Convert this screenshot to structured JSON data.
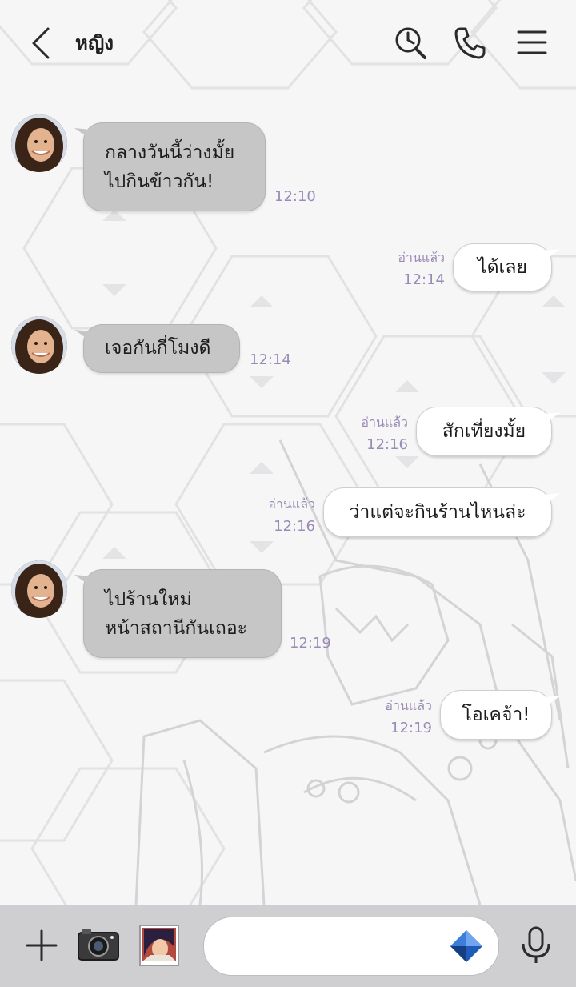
{
  "header": {
    "title": "หญิง",
    "back_icon": "chevron-left-icon",
    "actions": [
      "search-history-icon",
      "phone-icon",
      "menu-icon"
    ]
  },
  "messages": [
    {
      "side": "in",
      "lines": "กลางวันนี้ว่างมั้ย\nไปกินข้าวกัน!",
      "time": "12:10"
    },
    {
      "side": "out",
      "lines": "ได้เลย",
      "read": "อ่านแล้ว",
      "time": "12:14"
    },
    {
      "side": "in",
      "lines": "เจอกันกี่โมงดี",
      "time": "12:14"
    },
    {
      "side": "out",
      "lines": "สักเที่ยงมั้ย",
      "read": "อ่านแล้ว",
      "time": "12:16"
    },
    {
      "side": "out",
      "lines": "ว่าแต่จะกินร้านไหนล่ะ",
      "read": "อ่านแล้ว",
      "time": "12:16"
    },
    {
      "side": "in",
      "lines": "ไปร้านใหม่\nหน้าสถานีกันเถอะ",
      "time": "12:19"
    },
    {
      "side": "out",
      "lines": "โอเคจ้า!",
      "read": "อ่านแล้ว",
      "time": "12:19"
    }
  ],
  "footer": {
    "icons": [
      "plus-icon",
      "camera-icon",
      "photo-thumbnail",
      "diamond-icon",
      "microphone-icon"
    ],
    "input_value": ""
  },
  "colors": {
    "incoming_bubble": "#c6c6c6",
    "outgoing_bubble": "#ffffff",
    "meta_text": "#9a8bb6",
    "footer_bar": "#cfcfd1",
    "diamond_accent": "#2a6fd0"
  }
}
